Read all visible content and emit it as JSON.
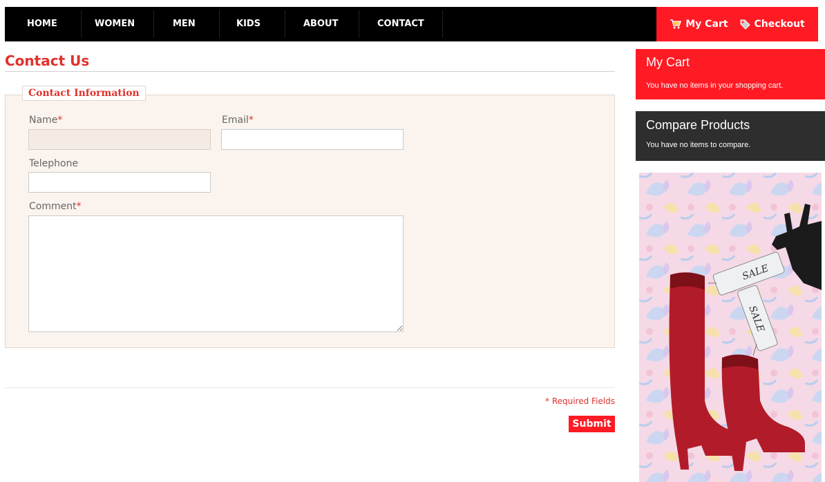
{
  "nav": {
    "items": [
      "HOME",
      "WOMEN",
      "MEN",
      "KIDS",
      "ABOUT",
      "CONTACT"
    ],
    "cart_label": "My Cart",
    "checkout_label": "Checkout"
  },
  "page": {
    "title": "Contact Us"
  },
  "form": {
    "legend": "Contact Information",
    "name_label": "Name",
    "email_label": "Email",
    "telephone_label": "Telephone",
    "comment_label": "Comment",
    "required_marker": "*",
    "name_value": "",
    "email_value": "",
    "telephone_value": "",
    "comment_value": "",
    "required_note": "* Required Fields",
    "submit_label": "Submit"
  },
  "sidebar": {
    "cart": {
      "title": "My Cart",
      "text": "You have no items in your shopping cart."
    },
    "compare": {
      "title": "Compare Products",
      "text": "You have no items to compare."
    },
    "ad": {
      "tag_text_1": "SALE",
      "tag_text_2": "SALE"
    }
  },
  "colors": {
    "accent": "#ff1a24",
    "title_red": "#e0312b",
    "nav_bg": "#000000",
    "compare_bg": "#2e2e2e",
    "form_bg": "#fbf4ee"
  },
  "icons": {
    "cart": "shopping-cart-icon",
    "checkout": "tag-icon"
  }
}
